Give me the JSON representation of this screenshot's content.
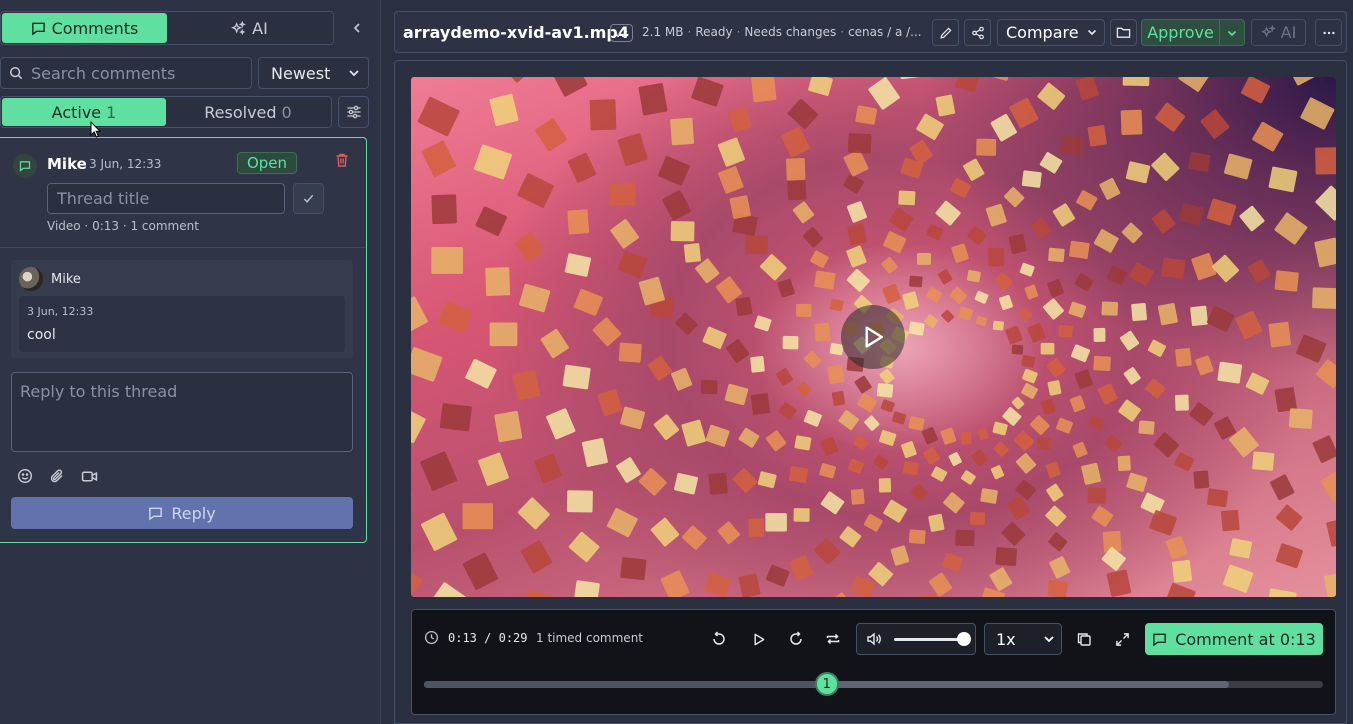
{
  "sidebar": {
    "tabs": [
      {
        "label": "Comments",
        "icon": "chat-icon",
        "active": true
      },
      {
        "label": "AI",
        "icon": "sparkle-icon",
        "active": false
      }
    ],
    "search_placeholder": "Search comments",
    "sort_value": "Newest",
    "filters": [
      {
        "label": "Active",
        "count": "1",
        "active": true
      },
      {
        "label": "Resolved",
        "count": "0",
        "active": false
      }
    ],
    "thread": {
      "author": "Mike",
      "time": "3 Jun, 12:33",
      "status": "Open",
      "title_placeholder": "Thread title",
      "meta": "Video · 0:13 · 1 comment",
      "comments": [
        {
          "author": "Mike",
          "date": "3 Jun, 12:33",
          "text": "cool"
        }
      ],
      "reply_placeholder": "Reply to this thread",
      "reply_label": "Reply"
    }
  },
  "topbar": {
    "file_name": "arraydemo-xvid-av1.mp4",
    "version": "v2",
    "size": "2.1 MB",
    "state": "Ready",
    "review_status": "Needs changes",
    "path": "cenas / a /...",
    "compare_label": "Compare",
    "approve_label": "Approve",
    "ai_label": "AI"
  },
  "player": {
    "current_time": "0:13",
    "duration": "0:29",
    "time_sep": " / ",
    "timed_comments": "1 timed comment",
    "speed": "1x",
    "volume_level": 0.9,
    "comment_at_label": "Comment at 0:13",
    "progress_fraction": 0.448,
    "buffered_fraction": 0.895,
    "markers": [
      {
        "label": "1",
        "fraction": 0.448
      }
    ]
  },
  "colors": {
    "accent": "#5fe0a0",
    "reply_button": "#6272ad",
    "danger": "#e05b5b"
  }
}
